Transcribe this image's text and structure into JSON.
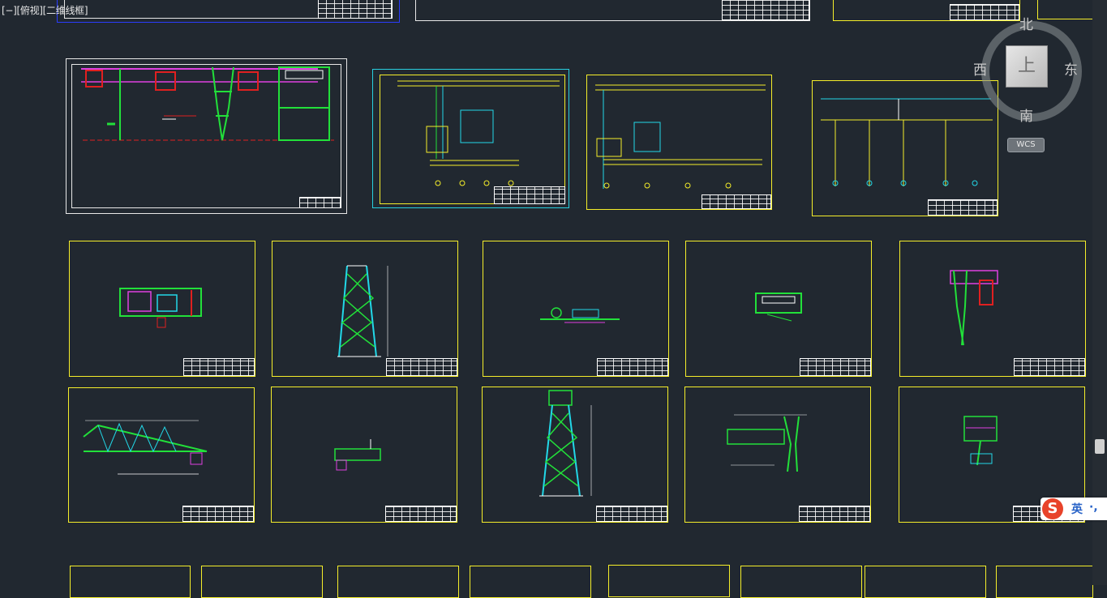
{
  "viewport": {
    "label": "[−][俯视][二维线框]",
    "background": "#212830"
  },
  "viewcube": {
    "north": "北",
    "south": "南",
    "east": "东",
    "west": "西",
    "top_face": "上",
    "wcs_label": "WCS"
  },
  "ime": {
    "logo": "S",
    "mode": "英",
    "punct": "·,"
  },
  "colors": {
    "sheet_white": "#e8e8e8",
    "sheet_cyan": "#28d0e0",
    "sheet_yellow": "#f5ee2a",
    "line_green": "#22e03a",
    "line_red": "#e02020",
    "line_magenta": "#e040e0",
    "line_cyan": "#22d8e8"
  }
}
